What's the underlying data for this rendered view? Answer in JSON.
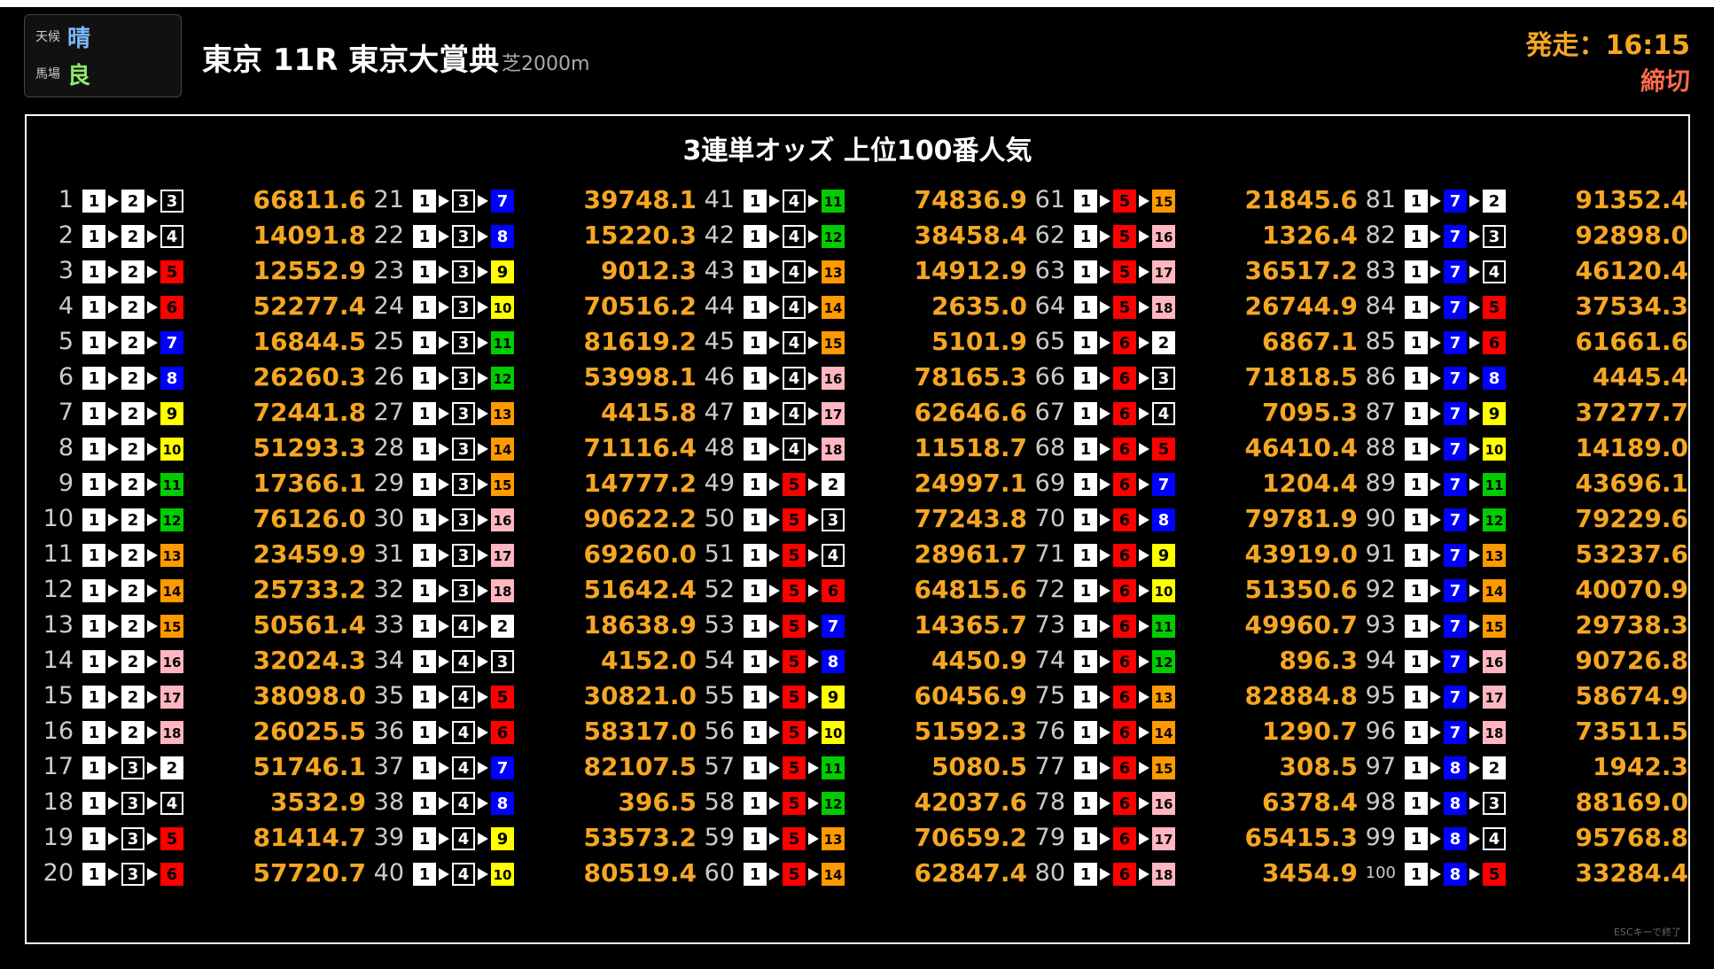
{
  "header": {
    "weather_label": "天候",
    "weather_value": "晴",
    "track_label": "馬場",
    "track_value": "良",
    "race_title": "東京 11R 東京大賞典",
    "distance": "芝2000m",
    "start_time": "発走：16:15",
    "status": "締切"
  },
  "panel": {
    "title": "3連単オッズ 上位100番人気",
    "esc_hint": "ESCキーで終了"
  },
  "colors": {
    "accent_orange": "#f5a623",
    "status_red": "#ff6a4d",
    "weather_blue": "#7db8ff",
    "track_green": "#8ee86a"
  },
  "horse_colors": {
    "1": [
      "#ffffff",
      "#000000"
    ],
    "2": [
      "#ffffff",
      "#000000"
    ],
    "3": [
      "#000000",
      "#ffffff"
    ],
    "4": [
      "#000000",
      "#ffffff"
    ],
    "5": [
      "#ff0000",
      "#000000"
    ],
    "6": [
      "#ff0000",
      "#000000"
    ],
    "7": [
      "#0000ff",
      "#ffffff"
    ],
    "8": [
      "#0000ff",
      "#ffffff"
    ],
    "9": [
      "#ffff00",
      "#000000"
    ],
    "10": [
      "#ffff00",
      "#000000"
    ],
    "11": [
      "#00cc00",
      "#000000"
    ],
    "12": [
      "#00cc00",
      "#000000"
    ],
    "13": [
      "#ff9900",
      "#000000"
    ],
    "14": [
      "#ff9900",
      "#000000"
    ],
    "15": [
      "#ff9900",
      "#000000"
    ],
    "16": [
      "#ffb6c1",
      "#000000"
    ],
    "17": [
      "#ffb6c1",
      "#000000"
    ],
    "18": [
      "#ffb6c1",
      "#000000"
    ]
  },
  "odds_list": [
    {
      "rank": "1",
      "combo": [
        1,
        2,
        3
      ],
      "odds": "66811.6"
    },
    {
      "rank": "2",
      "combo": [
        1,
        2,
        4
      ],
      "odds": "14091.8"
    },
    {
      "rank": "3",
      "combo": [
        1,
        2,
        5
      ],
      "odds": "12552.9"
    },
    {
      "rank": "4",
      "combo": [
        1,
        2,
        6
      ],
      "odds": "52277.4"
    },
    {
      "rank": "5",
      "combo": [
        1,
        2,
        7
      ],
      "odds": "16844.5"
    },
    {
      "rank": "6",
      "combo": [
        1,
        2,
        8
      ],
      "odds": "26260.3"
    },
    {
      "rank": "7",
      "combo": [
        1,
        2,
        9
      ],
      "odds": "72441.8"
    },
    {
      "rank": "8",
      "combo": [
        1,
        2,
        10
      ],
      "odds": "51293.3"
    },
    {
      "rank": "9",
      "combo": [
        1,
        2,
        11
      ],
      "odds": "17366.1"
    },
    {
      "rank": "10",
      "combo": [
        1,
        2,
        12
      ],
      "odds": "76126.0"
    },
    {
      "rank": "11",
      "combo": [
        1,
        2,
        13
      ],
      "odds": "23459.9"
    },
    {
      "rank": "12",
      "combo": [
        1,
        2,
        14
      ],
      "odds": "25733.2"
    },
    {
      "rank": "13",
      "combo": [
        1,
        2,
        15
      ],
      "odds": "50561.4"
    },
    {
      "rank": "14",
      "combo": [
        1,
        2,
        16
      ],
      "odds": "32024.3"
    },
    {
      "rank": "15",
      "combo": [
        1,
        2,
        17
      ],
      "odds": "38098.0"
    },
    {
      "rank": "16",
      "combo": [
        1,
        2,
        18
      ],
      "odds": "26025.5"
    },
    {
      "rank": "17",
      "combo": [
        1,
        3,
        2
      ],
      "odds": "51746.1"
    },
    {
      "rank": "18",
      "combo": [
        1,
        3,
        4
      ],
      "odds": "3532.9"
    },
    {
      "rank": "19",
      "combo": [
        1,
        3,
        5
      ],
      "odds": "81414.7"
    },
    {
      "rank": "20",
      "combo": [
        1,
        3,
        6
      ],
      "odds": "57720.7"
    },
    {
      "rank": "21",
      "combo": [
        1,
        3,
        7
      ],
      "odds": "39748.1"
    },
    {
      "rank": "22",
      "combo": [
        1,
        3,
        8
      ],
      "odds": "15220.3"
    },
    {
      "rank": "23",
      "combo": [
        1,
        3,
        9
      ],
      "odds": "9012.3"
    },
    {
      "rank": "24",
      "combo": [
        1,
        3,
        10
      ],
      "odds": "70516.2"
    },
    {
      "rank": "25",
      "combo": [
        1,
        3,
        11
      ],
      "odds": "81619.2"
    },
    {
      "rank": "26",
      "combo": [
        1,
        3,
        12
      ],
      "odds": "53998.1"
    },
    {
      "rank": "27",
      "combo": [
        1,
        3,
        13
      ],
      "odds": "4415.8"
    },
    {
      "rank": "28",
      "combo": [
        1,
        3,
        14
      ],
      "odds": "71116.4"
    },
    {
      "rank": "29",
      "combo": [
        1,
        3,
        15
      ],
      "odds": "14777.2"
    },
    {
      "rank": "30",
      "combo": [
        1,
        3,
        16
      ],
      "odds": "90622.2"
    },
    {
      "rank": "31",
      "combo": [
        1,
        3,
        17
      ],
      "odds": "69260.0"
    },
    {
      "rank": "32",
      "combo": [
        1,
        3,
        18
      ],
      "odds": "51642.4"
    },
    {
      "rank": "33",
      "combo": [
        1,
        4,
        2
      ],
      "odds": "18638.9"
    },
    {
      "rank": "34",
      "combo": [
        1,
        4,
        3
      ],
      "odds": "4152.0"
    },
    {
      "rank": "35",
      "combo": [
        1,
        4,
        5
      ],
      "odds": "30821.0"
    },
    {
      "rank": "36",
      "combo": [
        1,
        4,
        6
      ],
      "odds": "58317.0"
    },
    {
      "rank": "37",
      "combo": [
        1,
        4,
        7
      ],
      "odds": "82107.5"
    },
    {
      "rank": "38",
      "combo": [
        1,
        4,
        8
      ],
      "odds": "396.5"
    },
    {
      "rank": "39",
      "combo": [
        1,
        4,
        9
      ],
      "odds": "53573.2"
    },
    {
      "rank": "40",
      "combo": [
        1,
        4,
        10
      ],
      "odds": "80519.4"
    },
    {
      "rank": "41",
      "combo": [
        1,
        4,
        11
      ],
      "odds": "74836.9"
    },
    {
      "rank": "42",
      "combo": [
        1,
        4,
        12
      ],
      "odds": "38458.4"
    },
    {
      "rank": "43",
      "combo": [
        1,
        4,
        13
      ],
      "odds": "14912.9"
    },
    {
      "rank": "44",
      "combo": [
        1,
        4,
        14
      ],
      "odds": "2635.0"
    },
    {
      "rank": "45",
      "combo": [
        1,
        4,
        15
      ],
      "odds": "5101.9"
    },
    {
      "rank": "46",
      "combo": [
        1,
        4,
        16
      ],
      "odds": "78165.3"
    },
    {
      "rank": "47",
      "combo": [
        1,
        4,
        17
      ],
      "odds": "62646.6"
    },
    {
      "rank": "48",
      "combo": [
        1,
        4,
        18
      ],
      "odds": "11518.7"
    },
    {
      "rank": "49",
      "combo": [
        1,
        5,
        2
      ],
      "odds": "24997.1"
    },
    {
      "rank": "50",
      "combo": [
        1,
        5,
        3
      ],
      "odds": "77243.8"
    },
    {
      "rank": "51",
      "combo": [
        1,
        5,
        4
      ],
      "odds": "28961.7"
    },
    {
      "rank": "52",
      "combo": [
        1,
        5,
        6
      ],
      "odds": "64815.6"
    },
    {
      "rank": "53",
      "combo": [
        1,
        5,
        7
      ],
      "odds": "14365.7"
    },
    {
      "rank": "54",
      "combo": [
        1,
        5,
        8
      ],
      "odds": "4450.9"
    },
    {
      "rank": "55",
      "combo": [
        1,
        5,
        9
      ],
      "odds": "60456.9"
    },
    {
      "rank": "56",
      "combo": [
        1,
        5,
        10
      ],
      "odds": "51592.3"
    },
    {
      "rank": "57",
      "combo": [
        1,
        5,
        11
      ],
      "odds": "5080.5"
    },
    {
      "rank": "58",
      "combo": [
        1,
        5,
        12
      ],
      "odds": "42037.6"
    },
    {
      "rank": "59",
      "combo": [
        1,
        5,
        13
      ],
      "odds": "70659.2"
    },
    {
      "rank": "60",
      "combo": [
        1,
        5,
        14
      ],
      "odds": "62847.4"
    },
    {
      "rank": "61",
      "combo": [
        1,
        5,
        15
      ],
      "odds": "21845.6"
    },
    {
      "rank": "62",
      "combo": [
        1,
        5,
        16
      ],
      "odds": "1326.4"
    },
    {
      "rank": "63",
      "combo": [
        1,
        5,
        17
      ],
      "odds": "36517.2"
    },
    {
      "rank": "64",
      "combo": [
        1,
        5,
        18
      ],
      "odds": "26744.9"
    },
    {
      "rank": "65",
      "combo": [
        1,
        6,
        2
      ],
      "odds": "6867.1"
    },
    {
      "rank": "66",
      "combo": [
        1,
        6,
        3
      ],
      "odds": "71818.5"
    },
    {
      "rank": "67",
      "combo": [
        1,
        6,
        4
      ],
      "odds": "7095.3"
    },
    {
      "rank": "68",
      "combo": [
        1,
        6,
        5
      ],
      "odds": "46410.4"
    },
    {
      "rank": "69",
      "combo": [
        1,
        6,
        7
      ],
      "odds": "1204.4"
    },
    {
      "rank": "70",
      "combo": [
        1,
        6,
        8
      ],
      "odds": "79781.9"
    },
    {
      "rank": "71",
      "combo": [
        1,
        6,
        9
      ],
      "odds": "43919.0"
    },
    {
      "rank": "72",
      "combo": [
        1,
        6,
        10
      ],
      "odds": "51350.6"
    },
    {
      "rank": "73",
      "combo": [
        1,
        6,
        11
      ],
      "odds": "49960.7"
    },
    {
      "rank": "74",
      "combo": [
        1,
        6,
        12
      ],
      "odds": "896.3"
    },
    {
      "rank": "75",
      "combo": [
        1,
        6,
        13
      ],
      "odds": "82884.8"
    },
    {
      "rank": "76",
      "combo": [
        1,
        6,
        14
      ],
      "odds": "1290.7"
    },
    {
      "rank": "77",
      "combo": [
        1,
        6,
        15
      ],
      "odds": "308.5"
    },
    {
      "rank": "78",
      "combo": [
        1,
        6,
        16
      ],
      "odds": "6378.4"
    },
    {
      "rank": "79",
      "combo": [
        1,
        6,
        17
      ],
      "odds": "65415.3"
    },
    {
      "rank": "80",
      "combo": [
        1,
        6,
        18
      ],
      "odds": "3454.9"
    },
    {
      "rank": "81",
      "combo": [
        1,
        7,
        2
      ],
      "odds": "91352.4"
    },
    {
      "rank": "82",
      "combo": [
        1,
        7,
        3
      ],
      "odds": "92898.0"
    },
    {
      "rank": "83",
      "combo": [
        1,
        7,
        4
      ],
      "odds": "46120.4"
    },
    {
      "rank": "84",
      "combo": [
        1,
        7,
        5
      ],
      "odds": "37534.3"
    },
    {
      "rank": "85",
      "combo": [
        1,
        7,
        6
      ],
      "odds": "61661.6"
    },
    {
      "rank": "86",
      "combo": [
        1,
        7,
        8
      ],
      "odds": "4445.4"
    },
    {
      "rank": "87",
      "combo": [
        1,
        7,
        9
      ],
      "odds": "37277.7"
    },
    {
      "rank": "88",
      "combo": [
        1,
        7,
        10
      ],
      "odds": "14189.0"
    },
    {
      "rank": "89",
      "combo": [
        1,
        7,
        11
      ],
      "odds": "43696.1"
    },
    {
      "rank": "90",
      "combo": [
        1,
        7,
        12
      ],
      "odds": "79229.6"
    },
    {
      "rank": "91",
      "combo": [
        1,
        7,
        13
      ],
      "odds": "53237.6"
    },
    {
      "rank": "92",
      "combo": [
        1,
        7,
        14
      ],
      "odds": "40070.9"
    },
    {
      "rank": "93",
      "combo": [
        1,
        7,
        15
      ],
      "odds": "29738.3"
    },
    {
      "rank": "94",
      "combo": [
        1,
        7,
        16
      ],
      "odds": "90726.8"
    },
    {
      "rank": "95",
      "combo": [
        1,
        7,
        17
      ],
      "odds": "58674.9"
    },
    {
      "rank": "96",
      "combo": [
        1,
        7,
        18
      ],
      "odds": "73511.5"
    },
    {
      "rank": "97",
      "combo": [
        1,
        8,
        2
      ],
      "odds": "1942.3"
    },
    {
      "rank": "98",
      "combo": [
        1,
        8,
        3
      ],
      "odds": "88169.0"
    },
    {
      "rank": "99",
      "combo": [
        1,
        8,
        4
      ],
      "odds": "95768.8"
    },
    {
      "rank": "100",
      "combo": [
        1,
        8,
        5
      ],
      "odds": "33284.4"
    }
  ]
}
